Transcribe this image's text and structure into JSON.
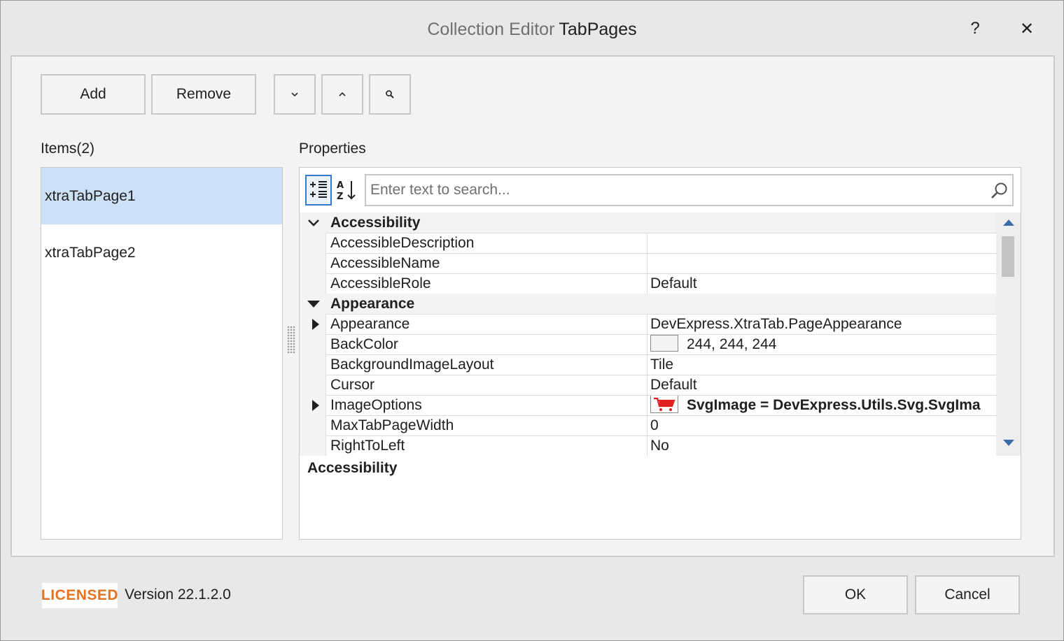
{
  "window": {
    "title_prefix": "Collection Editor",
    "title_main": "TabPages",
    "help_label": "?",
    "close_label": "✕"
  },
  "toolbar": {
    "add_label": "Add",
    "remove_label": "Remove",
    "move_down_icon": "chevron-down-icon",
    "move_up_icon": "chevron-up-icon",
    "search_icon": "search-icon"
  },
  "items": {
    "caption": "Items(2)",
    "list": [
      {
        "label": "xtraTabPage1",
        "selected": true
      },
      {
        "label": "xtraTabPage2",
        "selected": false
      }
    ]
  },
  "properties": {
    "caption": "Properties",
    "search_placeholder": "Enter text to search...",
    "categories": [
      {
        "name": "Accessibility",
        "rows": [
          {
            "name": "AccessibleDescription",
            "value": ""
          },
          {
            "name": "AccessibleName",
            "value": ""
          },
          {
            "name": "AccessibleRole",
            "value": "Default"
          }
        ]
      },
      {
        "name": "Appearance",
        "rows": [
          {
            "name": "Appearance",
            "value": "DevExpress.XtraTab.PageAppearance"
          },
          {
            "name": "BackColor",
            "value": "244, 244, 244",
            "swatch_color": "#f4f4f4"
          },
          {
            "name": "BackgroundImageLayout",
            "value": "Tile"
          },
          {
            "name": "Cursor",
            "value": "Default"
          },
          {
            "name": "ImageOptions",
            "value": "SvgImage = DevExpress.Utils.Svg.SvgIma"
          },
          {
            "name": "MaxTabPageWidth",
            "value": "0"
          },
          {
            "name": "RightToLeft",
            "value": "No"
          }
        ]
      }
    ],
    "description_title": "Accessibility"
  },
  "footer": {
    "licensed_label": "LICENSED",
    "version": "Version 22.1.2.0",
    "ok_label": "OK",
    "cancel_label": "Cancel"
  },
  "colors": {
    "selection": "#cce0f6",
    "licensed": "#e37222",
    "active_icon_border": "#3a78c8",
    "cart_red": "#e02020"
  }
}
